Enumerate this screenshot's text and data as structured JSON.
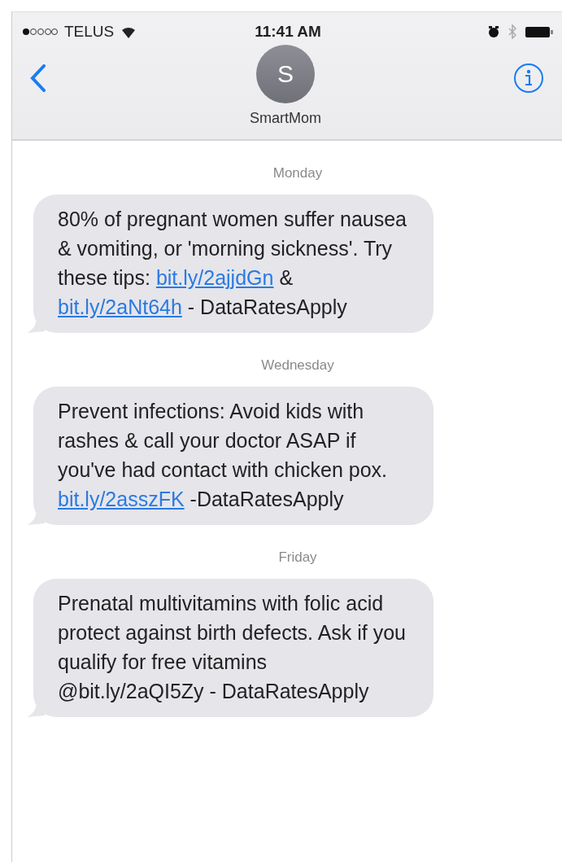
{
  "status_bar": {
    "carrier": "TELUS",
    "time": "11:41 AM"
  },
  "header": {
    "avatar_initial": "S",
    "contact_name": "SmartMom"
  },
  "conversation": [
    {
      "day": "Monday",
      "message": [
        {
          "text": "80% of pregnant women suffer nausea & vomiting, or 'morning sickness'. Try these tips: ",
          "link": false
        },
        {
          "text": "bit.ly/2ajjdGn",
          "link": true
        },
        {
          "text": " & ",
          "link": false
        },
        {
          "text": "bit.ly/2aNt64h",
          "link": true
        },
        {
          "text": " - DataRatesApply",
          "link": false
        }
      ]
    },
    {
      "day": "Wednesday",
      "message": [
        {
          "text": "Prevent infections: Avoid kids with rashes & call your doctor ASAP if you've had contact with chicken pox. ",
          "link": false
        },
        {
          "text": "bit.ly/2asszFK",
          "link": true
        },
        {
          "text": " -DataRatesApply",
          "link": false
        }
      ]
    },
    {
      "day": "Friday",
      "message": [
        {
          "text": "Prenatal multivitamins with folic acid protect against birth defects. Ask if you qualify for free vitamins @bit.ly/2aQI5Zy - DataRatesApply",
          "link": false
        }
      ]
    }
  ]
}
